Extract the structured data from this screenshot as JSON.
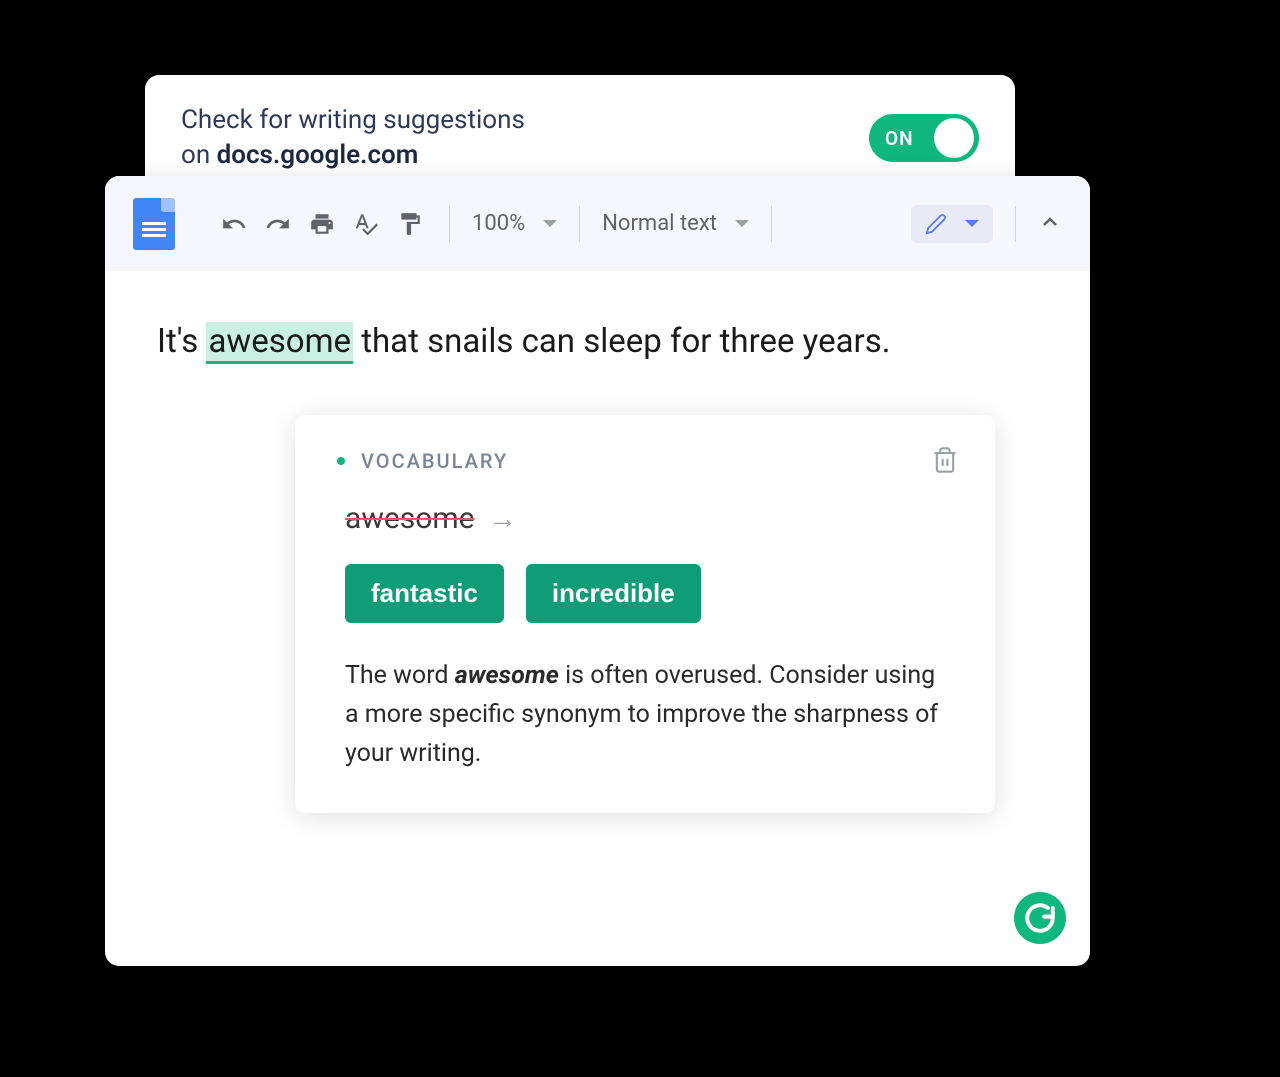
{
  "topCard": {
    "line1": "Check for writing suggestions",
    "line2_prefix": "on ",
    "domain": "docs.google.com",
    "toggle_label": "ON"
  },
  "toolbar": {
    "zoom": "100%",
    "text_style": "Normal text"
  },
  "document": {
    "sentence_before": "It's ",
    "highlighted_word": "awesome",
    "sentence_after": " that snails can sleep for three years."
  },
  "suggestion": {
    "category": "VOCABULARY",
    "original_word": "awesome",
    "alternatives": [
      "fantastic",
      "incredible"
    ],
    "explanation_pre": "The word ",
    "explanation_word": "awesome",
    "explanation_post": " is often overused. Consider using a more specific synonym to improve the sharpness of your writing."
  },
  "colors": {
    "accent": "#0fb77f",
    "accent_dark": "#0f9d77"
  }
}
